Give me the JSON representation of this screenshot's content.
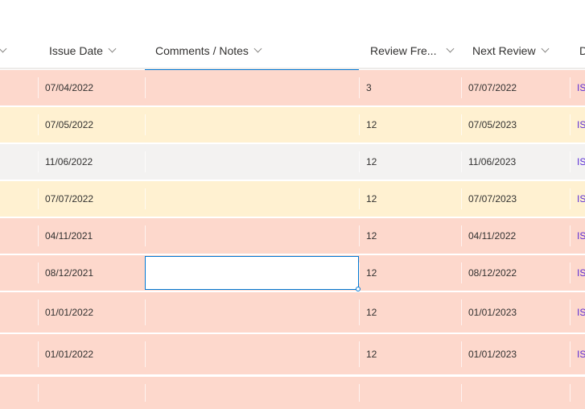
{
  "columns": [
    {
      "label": "Issue Date"
    },
    {
      "label": "Comments / Notes"
    },
    {
      "label": "Review Fre..."
    },
    {
      "label": "Next Review"
    },
    {
      "label": "D"
    }
  ],
  "colors": {
    "red": "#fdd8cc",
    "yellow": "#fff1d1",
    "gray": "#f3f2f1",
    "accent": "#0078d4"
  },
  "rows": [
    {
      "issue": "07/04/2022",
      "comments": "",
      "freq": "3",
      "next": "07/07/2022",
      "link": "IS",
      "color": "red"
    },
    {
      "issue": "07/05/2022",
      "comments": "",
      "freq": "12",
      "next": "07/05/2023",
      "link": "IS",
      "color": "yellow"
    },
    {
      "issue": "11/06/2022",
      "comments": "",
      "freq": "12",
      "next": "11/06/2023",
      "link": "IS",
      "color": "gray"
    },
    {
      "issue": "07/07/2022",
      "comments": "",
      "freq": "12",
      "next": "07/07/2023",
      "link": "IS",
      "color": "yellow"
    },
    {
      "issue": "04/11/2021",
      "comments": "",
      "freq": "12",
      "next": "04/11/2022",
      "link": "IS",
      "color": "red"
    },
    {
      "issue": "08/12/2021",
      "comments": "",
      "freq": "12",
      "next": "08/12/2022",
      "link": "IS",
      "color": "red"
    },
    {
      "issue": "01/01/2022",
      "comments": "",
      "freq": "12",
      "next": "01/01/2023",
      "link": "IS",
      "color": "red"
    },
    {
      "issue": "01/01/2022",
      "comments": "",
      "freq": "12",
      "next": "01/01/2023",
      "link": "IS",
      "color": "red"
    },
    {
      "issue": "",
      "comments": "",
      "freq": "",
      "next": "",
      "link": "",
      "color": "red"
    }
  ]
}
